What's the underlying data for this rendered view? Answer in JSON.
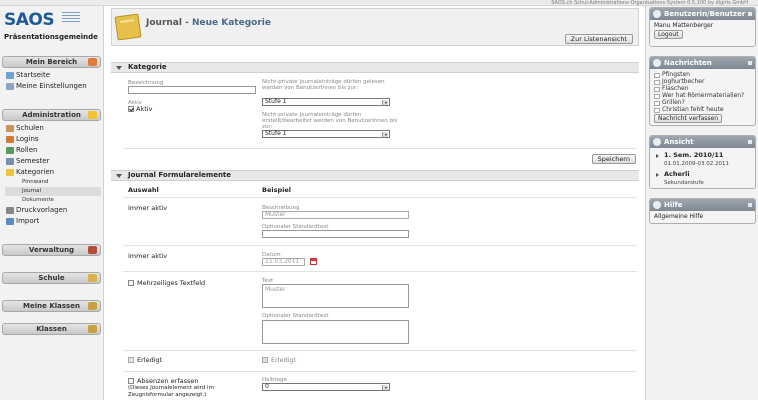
{
  "topbar": {
    "text": "SAOS.ch Schul-Administrations-Organisations-System 0.5.100 by digiris GmbH"
  },
  "brand": {
    "logo": "SAOS",
    "school": "Präsentationsgemeinde"
  },
  "sidebar": {
    "mein_bereich": {
      "title": "Mein Bereich",
      "items": [
        "Startseite",
        "Meine Einstellungen"
      ]
    },
    "administration": {
      "title": "Administration",
      "items": [
        "Schulen",
        "Logins",
        "Rollen",
        "Semester",
        "Kategorien"
      ],
      "subitems": [
        "Pinnwand",
        "Journal",
        "Dokumente"
      ],
      "items2": [
        "Druckvorlagen",
        "Import"
      ]
    },
    "verwaltung": "Verwaltung",
    "schule": "Schule",
    "meine_klassen": "Meine Klassen",
    "klassen": "Klassen"
  },
  "header": {
    "title": "Journal",
    "subtitle": "- Neue Kategorie",
    "back_button": "Zur Listenansicht"
  },
  "kategorie": {
    "panel_title": "Kategorie",
    "bezeichnung_label": "Bezeichnung",
    "aktiv_label": "Aktiv",
    "aktiv_checkbox": "Aktiv",
    "read_label": "Nicht-private Journaleinträge dürfen gelesen werden von BenutzerInnen bis zur:",
    "read_value": "Stufe 1",
    "edit_label": "Nicht-private Journaleinträge dürfen erstellt/bearbeitet werden von BenutzerInnen bis zur:",
    "edit_value": "Stufe 1",
    "save_button": "Speichern"
  },
  "formular": {
    "panel_title": "Journal Formularelemente",
    "col_auswahl": "Auswahl",
    "col_beispiel": "Beispiel",
    "rows": {
      "r1": {
        "auswahl": "immer aktiv",
        "label1": "Beschreibung",
        "value1": "Muster",
        "label2": "Optionaler Standardtext"
      },
      "r2": {
        "auswahl": "immer aktiv",
        "label1": "Datum",
        "value1": "11.03.2011"
      },
      "r3": {
        "auswahl": "Mehrzeiliges Textfeld",
        "label1": "Text",
        "value1": "Muster",
        "label2": "Optionaler Standardtext"
      },
      "r4": {
        "auswahl": "Erledigt",
        "beispiel": "Erledigt"
      },
      "r5": {
        "auswahl": "Absenzen erfassen",
        "note": "(Dieses Journalelement wird im Zeugnisformular angezeigt.)",
        "label1": "Halbtage",
        "value1": "0"
      }
    }
  },
  "right": {
    "user": {
      "title": "Benutzerin/Benutzer",
      "name": "Manu Mattenberger",
      "logout": "Logout"
    },
    "news": {
      "title": "Nachrichten",
      "items": [
        "Pfingsten",
        "Joghurtbecher",
        "Flaschen",
        "Wer hat Römermaterialien?",
        "Grillen?",
        "Christian fehlt heute"
      ],
      "button": "Nachricht verfassen"
    },
    "ansicht": {
      "title": "Ansicht",
      "semester": "1. Sem. 2010/11",
      "semester_dates": "01.01.2009-03.02.2011",
      "ort": "Acherli",
      "stufe": "Sekundarstufe"
    },
    "hilfe": {
      "title": "Hilfe",
      "text": "Allgemeine Hilfe"
    }
  }
}
